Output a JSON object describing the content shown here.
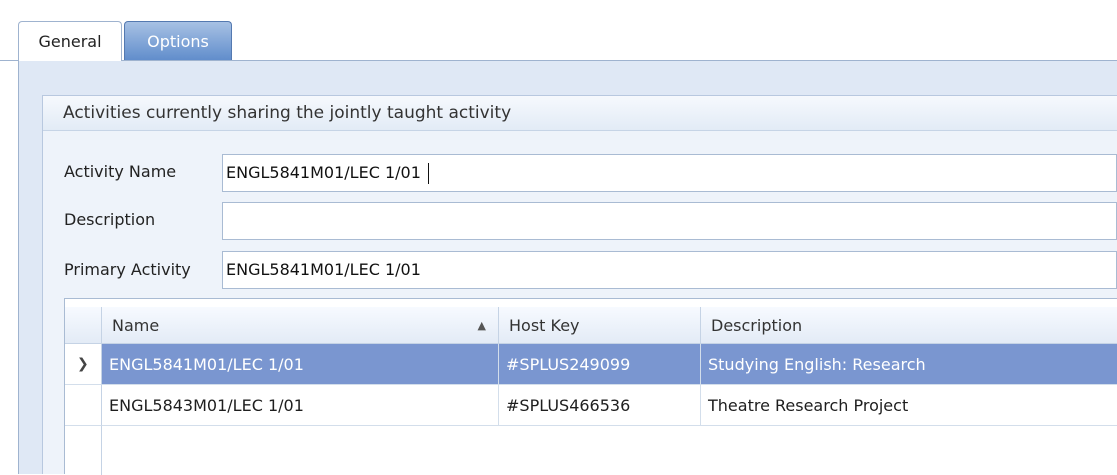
{
  "tabs": [
    {
      "label": "General"
    },
    {
      "label": "Options"
    }
  ],
  "group": {
    "title": "Activities currently sharing the jointly taught activity"
  },
  "form": {
    "activity_name": {
      "label": "Activity Name",
      "value": "ENGL5841M01/LEC 1/01"
    },
    "description": {
      "label": "Description",
      "value": ""
    },
    "primary_activity": {
      "label": "Primary Activity",
      "value": "ENGL5841M01/LEC 1/01"
    }
  },
  "grid": {
    "columns": [
      "Name",
      "Host Key",
      "Description"
    ],
    "sort": {
      "column": "Name",
      "direction": "ascending"
    },
    "rows": [
      {
        "name": "ENGL5841M01/LEC 1/01",
        "host_key": "#SPLUS249099",
        "description": "Studying English: Research",
        "selected": true
      },
      {
        "name": "ENGL5843M01/LEC 1/01",
        "host_key": "#SPLUS466536",
        "description": "Theatre Research Project",
        "selected": false
      }
    ]
  },
  "colors": {
    "selected_row": "#7a96d0",
    "tab_active": "#5f8ccb"
  }
}
